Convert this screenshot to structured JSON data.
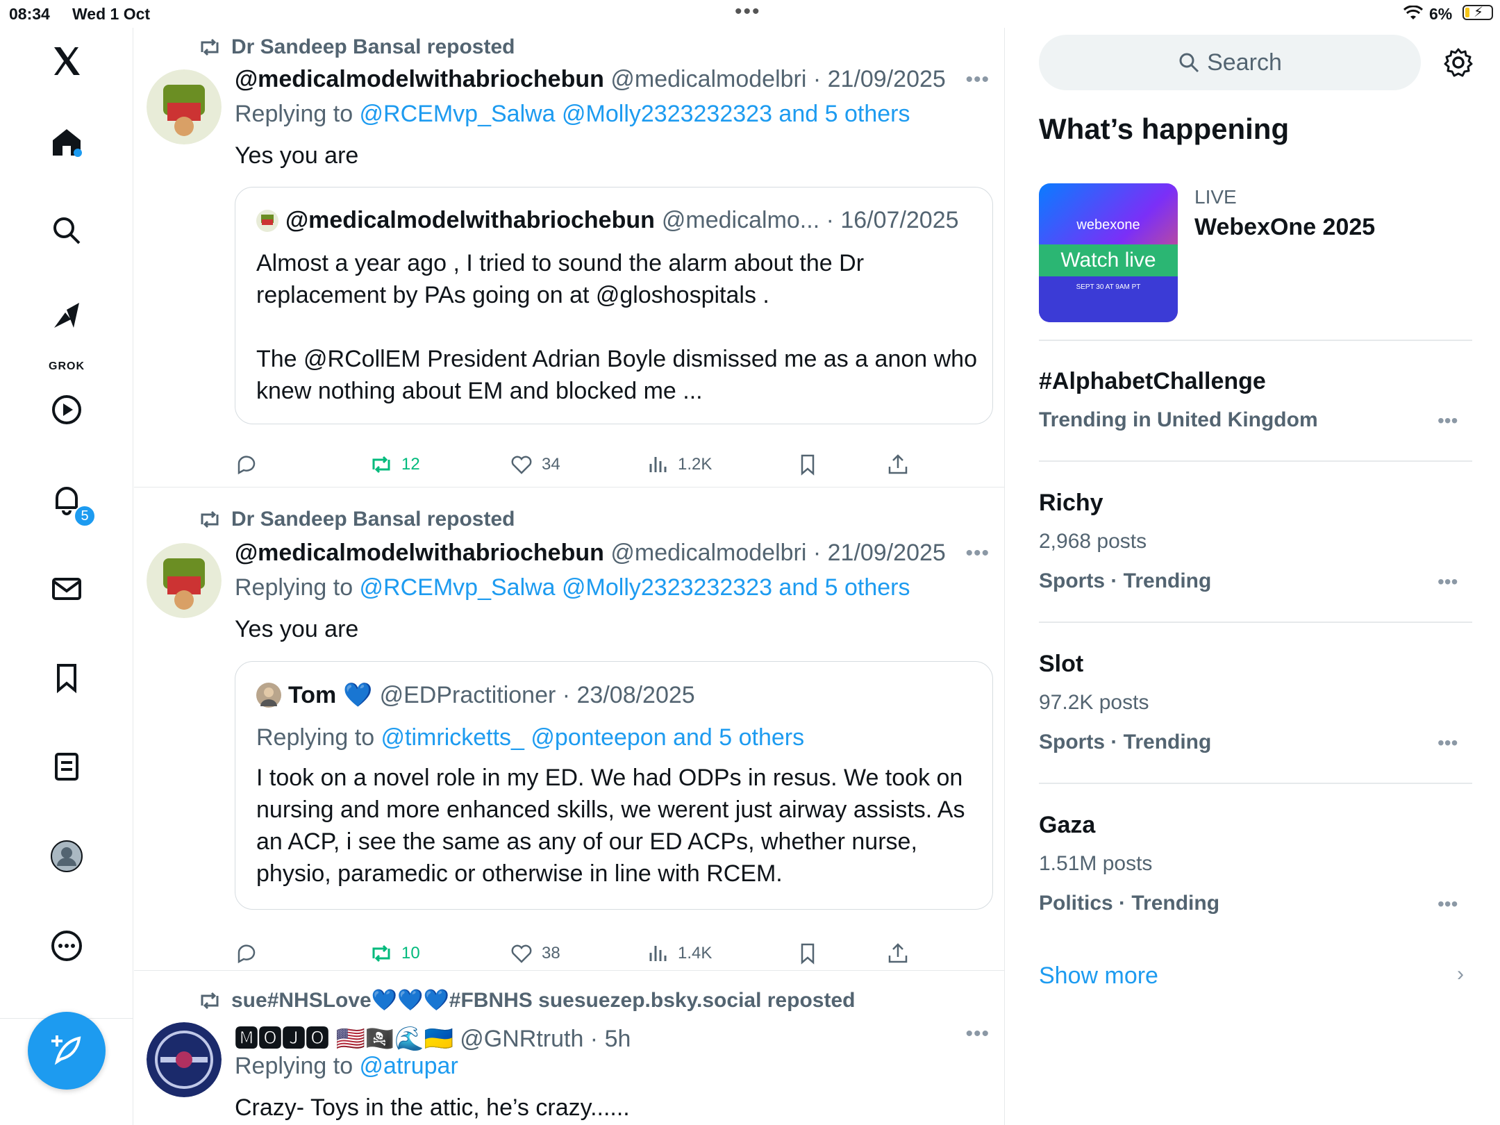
{
  "status": {
    "time": "08:34",
    "date": "Wed 1 Oct",
    "battery": "6%"
  },
  "nav": {
    "grok_label": "GROK",
    "notifications_badge": "5",
    "items": [
      "x-logo",
      "home",
      "search",
      "grok",
      "video",
      "notifications",
      "messages",
      "bookmarks",
      "lists",
      "profile",
      "more"
    ]
  },
  "tweets": [
    {
      "reposted_by": "Dr Sandeep Bansal reposted",
      "name": "@medicalmodelwithabriochebun",
      "handle_date": "@medicalmodelbri · 21/09/2025",
      "replying_prefix": "Replying to ",
      "replying_to": "@RCEMvp_Salwa @Molly2323232323 and 5 others",
      "text": "Yes you are",
      "quote": {
        "name": "@medicalmodelwithabriochebun",
        "handle_date": "@medicalmo... · 16/07/2025",
        "text": "Almost a year ago , I tried to sound the alarm about the Dr replacement by PAs going on at @gloshospitals .\n\nThe @RCollEM President Adrian Boyle dismissed me as a anon who knew nothing about EM and blocked me ..."
      },
      "reposts": "12",
      "likes": "34",
      "views": "1.2K"
    },
    {
      "reposted_by": "Dr Sandeep Bansal reposted",
      "name": "@medicalmodelwithabriochebun",
      "handle_date": "@medicalmodelbri · 21/09/2025",
      "replying_prefix": "Replying to ",
      "replying_to": "@RCEMvp_Salwa @Molly2323232323 and 5 others",
      "text": "Yes you are",
      "quote": {
        "name": "Tom",
        "name_emoji": "💙",
        "handle_date": "@EDPractitioner · 23/08/2025",
        "replying_prefix": "Replying to ",
        "replying_to": "@timricketts_ @ponteepon and 5 others",
        "text": "I took on a novel role in my ED. We had ODPs in resus. We took on nursing and more enhanced skills, we werent just airway assists. As an ACP, i see the same as any of our ED ACPs, whether nurse, physio, paramedic or otherwise in line with RCEM."
      },
      "reposts": "10",
      "likes": "38",
      "views": "1.4K"
    },
    {
      "reposted_by": "sue#NHSLove💙💙💙#FBNHS suesuezep.bsky.social reposted",
      "name": "🅼🅾🅹🅾 🇺🇸🏴‍☠️🌊🇺🇦",
      "handle_date": "@GNRtruth · 5h",
      "replying_prefix": "Replying to ",
      "replying_to": "@atrupar",
      "text": "Crazy- Toys in the attic, he’s crazy......"
    }
  ],
  "sidebar": {
    "search_placeholder": "Search",
    "section_title": "What’s happening",
    "live": {
      "label": "LIVE",
      "title": "WebexOne 2025",
      "thumb_brand": "webexone",
      "thumb_cta": "Watch live",
      "thumb_date": "SEPT 30 AT 9AM PT"
    },
    "trends": [
      {
        "title": "#AlphabetChallenge",
        "sub": "",
        "category": "Trending in United Kingdom"
      },
      {
        "title": "Richy",
        "sub": "2,968 posts",
        "category": "Sports · Trending"
      },
      {
        "title": "Slot",
        "sub": "97.2K posts",
        "category": "Sports · Trending"
      },
      {
        "title": "Gaza",
        "sub": "1.51M posts",
        "category": "Politics · Trending"
      }
    ],
    "show_more": "Show more"
  },
  "colors": {
    "accent": "#1d9bf0",
    "repost_green": "#00ba7c",
    "muted": "#536471"
  }
}
